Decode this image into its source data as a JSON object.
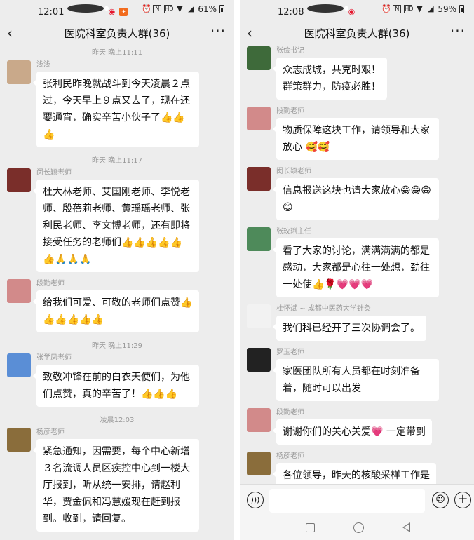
{
  "left": {
    "status": {
      "time": "12:01",
      "icons_left": [
        "message-icon",
        "weibo-icon",
        "app-icon"
      ],
      "icons_right": [
        "alarm-icon",
        "nfc-icon",
        "hd-icon",
        "wifi-icon",
        "signal-icon"
      ],
      "battery": "61%"
    },
    "title": "医院科室负责人群(36)",
    "items": [
      {
        "type": "time",
        "text": "昨天 晚上11:11"
      },
      {
        "type": "msg",
        "sender": "浅浅",
        "avatar_color": "#c9a98a",
        "text": "张利民昨晚就战斗到今天凌晨２点过，今天早上９点又去了，现在还要通宵，确实辛苦小伙子了👍👍👍"
      },
      {
        "type": "time",
        "text": "昨天 晚上11:17"
      },
      {
        "type": "msg",
        "sender": "闵长颖老师",
        "avatar_color": "#7a2e2a",
        "text": "杜大林老师、艾国刚老师、李悦老师、殷蓓莉老师、黄瑶瑶老师、张利民老师、李文博老师，还有即将接受任务的老师们👍👍👍👍👍👍🙏🙏🙏"
      },
      {
        "type": "msg",
        "sender": "段勤老师",
        "avatar_color": "#d28a8a",
        "text": "给我们可爱、可敬的老师们点赞👍👍👍👍👍👍"
      },
      {
        "type": "time",
        "text": "昨天 晚上11:29"
      },
      {
        "type": "msg",
        "sender": "张学凤老师",
        "avatar_color": "#5a8ed6",
        "text": "致敬冲锋在前的白衣天使们，为他们点赞，真的辛苦了！👍👍👍"
      },
      {
        "type": "time",
        "text": "凌晨12:03"
      },
      {
        "type": "msg",
        "sender": "杨彦老师",
        "avatar_color": "#8a6d3b",
        "text": "紧急通知，因需要，每个中心新增３名流调人员区疾控中心到一楼大厅报到，听从统一安排，请赵利华，贾金佩和冯慧媛现在赶到报到。收到，请回复。"
      }
    ]
  },
  "right": {
    "status": {
      "time": "12:08",
      "icons_left": [
        "message-icon",
        "weibo-icon"
      ],
      "icons_right": [
        "alarm-icon",
        "nfc-icon",
        "hd-icon",
        "wifi-icon",
        "signal-icon"
      ],
      "battery": "59%"
    },
    "title": "医院科室负责人群(36)",
    "items": [
      {
        "type": "msg",
        "sender": "张俭书记",
        "avatar_color": "#3e6a3a",
        "text": "众志成城，共克时艰！\n群策群力，防疫必胜！"
      },
      {
        "type": "msg",
        "sender": "段勤老师",
        "avatar_color": "#d28a8a",
        "text": "物质保障这块工作，请领导和大家放心 🥰🥰"
      },
      {
        "type": "msg",
        "sender": "闵长颖老师",
        "avatar_color": "#7a2e2a",
        "text": "信息报送这块也请大家放心😁😁😁😊"
      },
      {
        "type": "msg",
        "sender": "张玫琍主任",
        "avatar_color": "#4e8a5a",
        "text": "看了大家的讨论，满满满满的都是感动，大家都是心往一处想，劲往一处使👍🌹💗💗💗"
      },
      {
        "type": "msg",
        "sender": "杜怀斌 ~ 成都中医药大学针灸",
        "avatar_color": "#f2f2f2",
        "text": "我们科已经开了三次协调会了。"
      },
      {
        "type": "msg",
        "sender": "罗玉老师",
        "avatar_color": "#222222",
        "text": "家医团队所有人员都在时刻准备着，随时可以出发"
      },
      {
        "type": "msg",
        "sender": "段勤老师",
        "avatar_color": "#d28a8a",
        "text": "谢谢你们的关心关爱💗 一定带到"
      },
      {
        "type": "msg",
        "sender": "杨彦老师",
        "avatar_color": "#8a6d3b",
        "text": "各位领导，昨天的核酸采样工作是"
      }
    ]
  }
}
